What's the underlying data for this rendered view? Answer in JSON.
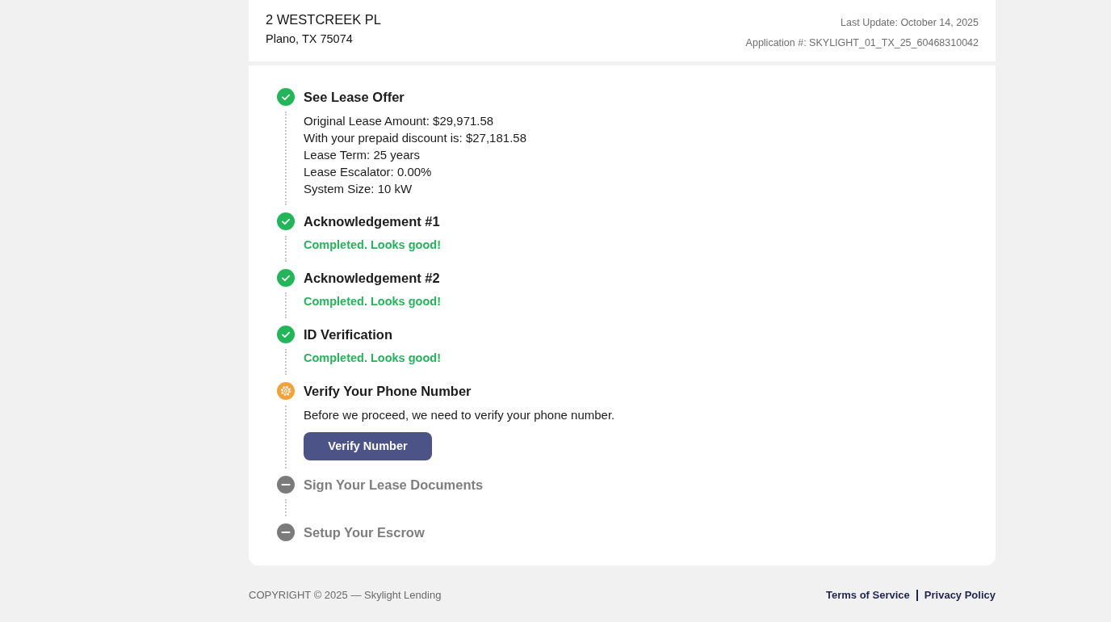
{
  "property": {
    "address_line1": "2 WESTCREEK PL",
    "address_line2": "Plano, TX 75074",
    "last_update": "Last Update: October 14, 2025",
    "application_number": "Application #: SKYLIGHT_01_TX_25_60468310042"
  },
  "steps": [
    {
      "title": "See Lease Offer",
      "completed": true,
      "active": false,
      "details": [
        "Original Lease Amount: $29,971.58",
        "With your prepaid discount is: $27,181.58",
        "Lease Term: 25 years",
        "Lease Escalator: 0.00%",
        "System Size: 10 kW"
      ]
    },
    {
      "title": "Acknowledgement #1",
      "completed": true,
      "active": false,
      "note": "Completed. Looks good!"
    },
    {
      "title": "Acknowledgement #2",
      "completed": true,
      "active": false,
      "note": "Completed. Looks good!"
    },
    {
      "title": "ID Verification",
      "completed": true,
      "active": false,
      "note": "Completed. Looks good!"
    },
    {
      "title": "Verify Your Phone Number",
      "completed": false,
      "active": true,
      "details": [
        "Before we proceed, we need to verify your phone number."
      ],
      "button": "Verify Number"
    },
    {
      "title": "Sign Your Lease Documents",
      "completed": false,
      "active": false
    },
    {
      "title": "Setup Your Escrow",
      "completed": false,
      "active": false
    }
  ],
  "footer": {
    "copyright": "COPYRIGHT © 2025 — Skylight Lending",
    "links": [
      "Terms of Service",
      "Privacy Policy"
    ]
  }
}
